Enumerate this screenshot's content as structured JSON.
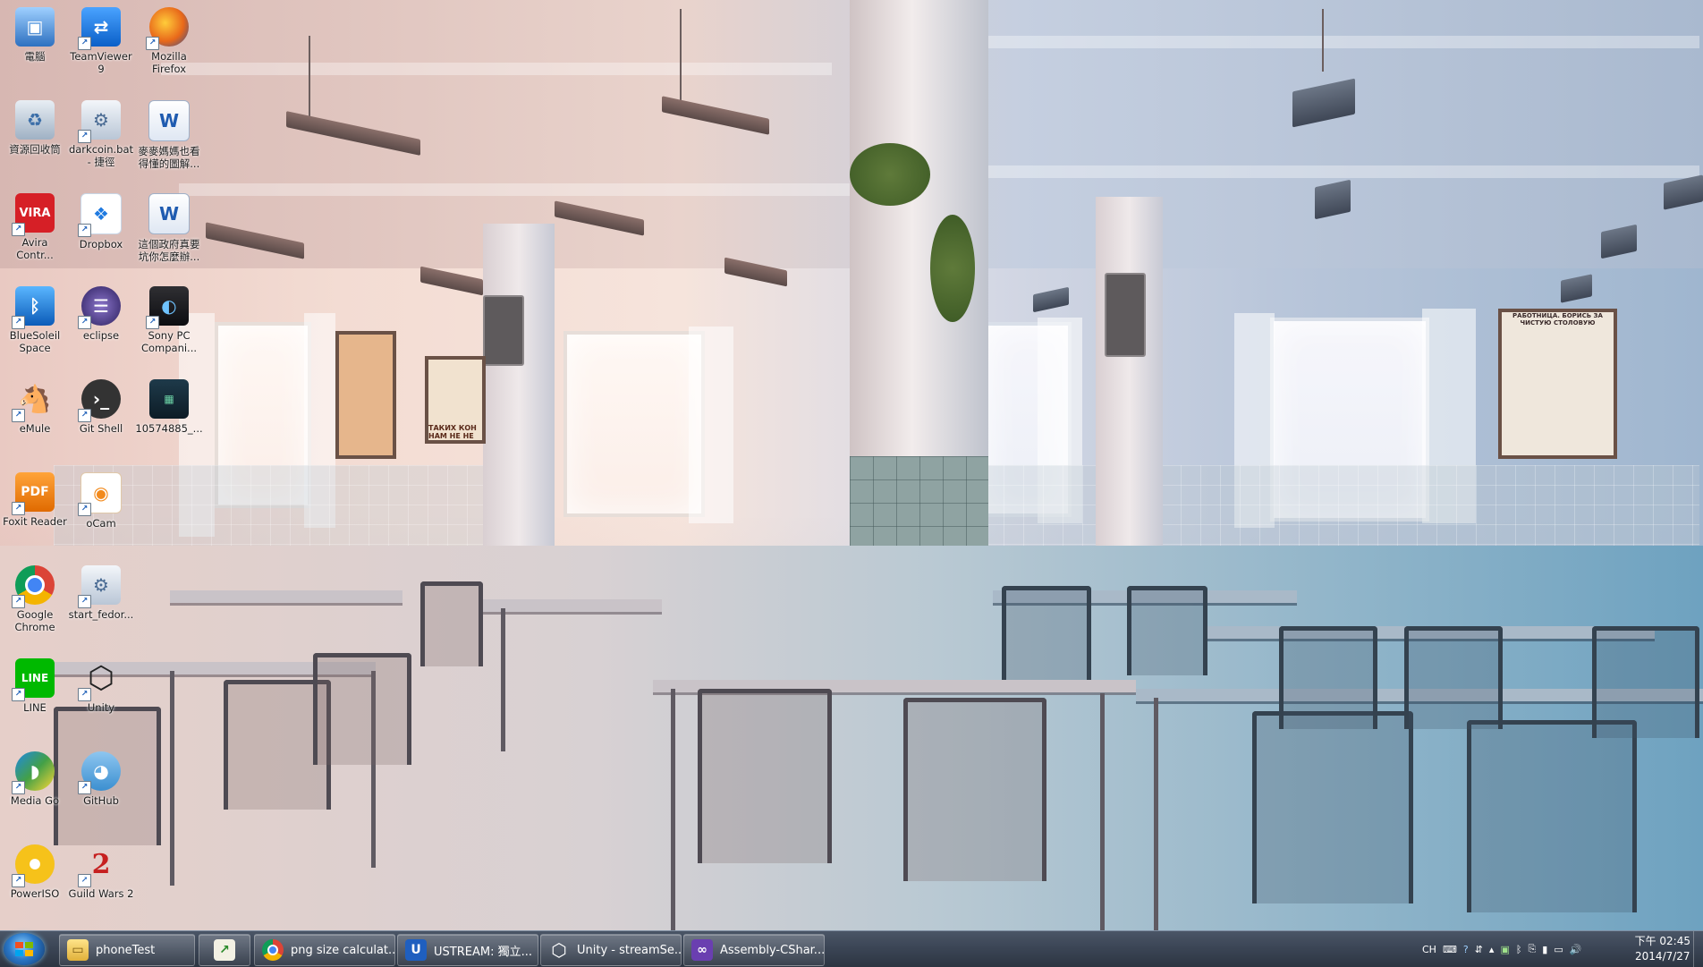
{
  "desktop": {
    "icons": [
      {
        "label": "電腦"
      },
      {
        "label": "TeamViewer\n9"
      },
      {
        "label": "Mozilla\nFirefox"
      },
      {
        "label": "資源回收筒"
      },
      {
        "label": "darkcoin.bat\n- 捷徑"
      },
      {
        "label": "麥麥媽媽也看\n得懂的圖解..."
      },
      {
        "label": "Avira\nContr..."
      },
      {
        "label": "Dropbox"
      },
      {
        "label": "這個政府真要\n坑你怎麼辦..."
      },
      {
        "label": "BlueSoleil\nSpace"
      },
      {
        "label": "eclipse"
      },
      {
        "label": "Sony PC\nCompani..."
      },
      {
        "label": "eMule"
      },
      {
        "label": "Git Shell"
      },
      {
        "label": "10574885_..."
      },
      {
        "label": "Foxit Reader"
      },
      {
        "label": "oCam"
      },
      {
        "label": "Google\nChrome"
      },
      {
        "label": "start_fedor..."
      },
      {
        "label": "LINE"
      },
      {
        "label": "Unity"
      },
      {
        "label": "Media Go"
      },
      {
        "label": "GitHub"
      },
      {
        "label": "PowerISO"
      },
      {
        "label": "Guild Wars 2"
      }
    ]
  },
  "wallpaper": {
    "poster_text_1": "ТАКИХ КОН\nНАМ НЕ НЕ",
    "poster_text_2": "РАБОТНИЦА. БОРИСЬ\nЗА ЧИСТУЮ СТОЛОВУЮ"
  },
  "taskbar": {
    "buttons": [
      {
        "label": "phoneTest"
      },
      {
        "label": ""
      },
      {
        "label": "png size calculat..."
      },
      {
        "label": "USTREAM: 獨立..."
      },
      {
        "label": "Unity - streamSe..."
      },
      {
        "label": "Assembly-CShar..."
      }
    ],
    "tray": {
      "language": "CH",
      "time": "下午 02:45",
      "date": "2014/7/27"
    }
  },
  "colors": {
    "taskbar": "#3a4454",
    "start_orb": "#2a78c8"
  }
}
